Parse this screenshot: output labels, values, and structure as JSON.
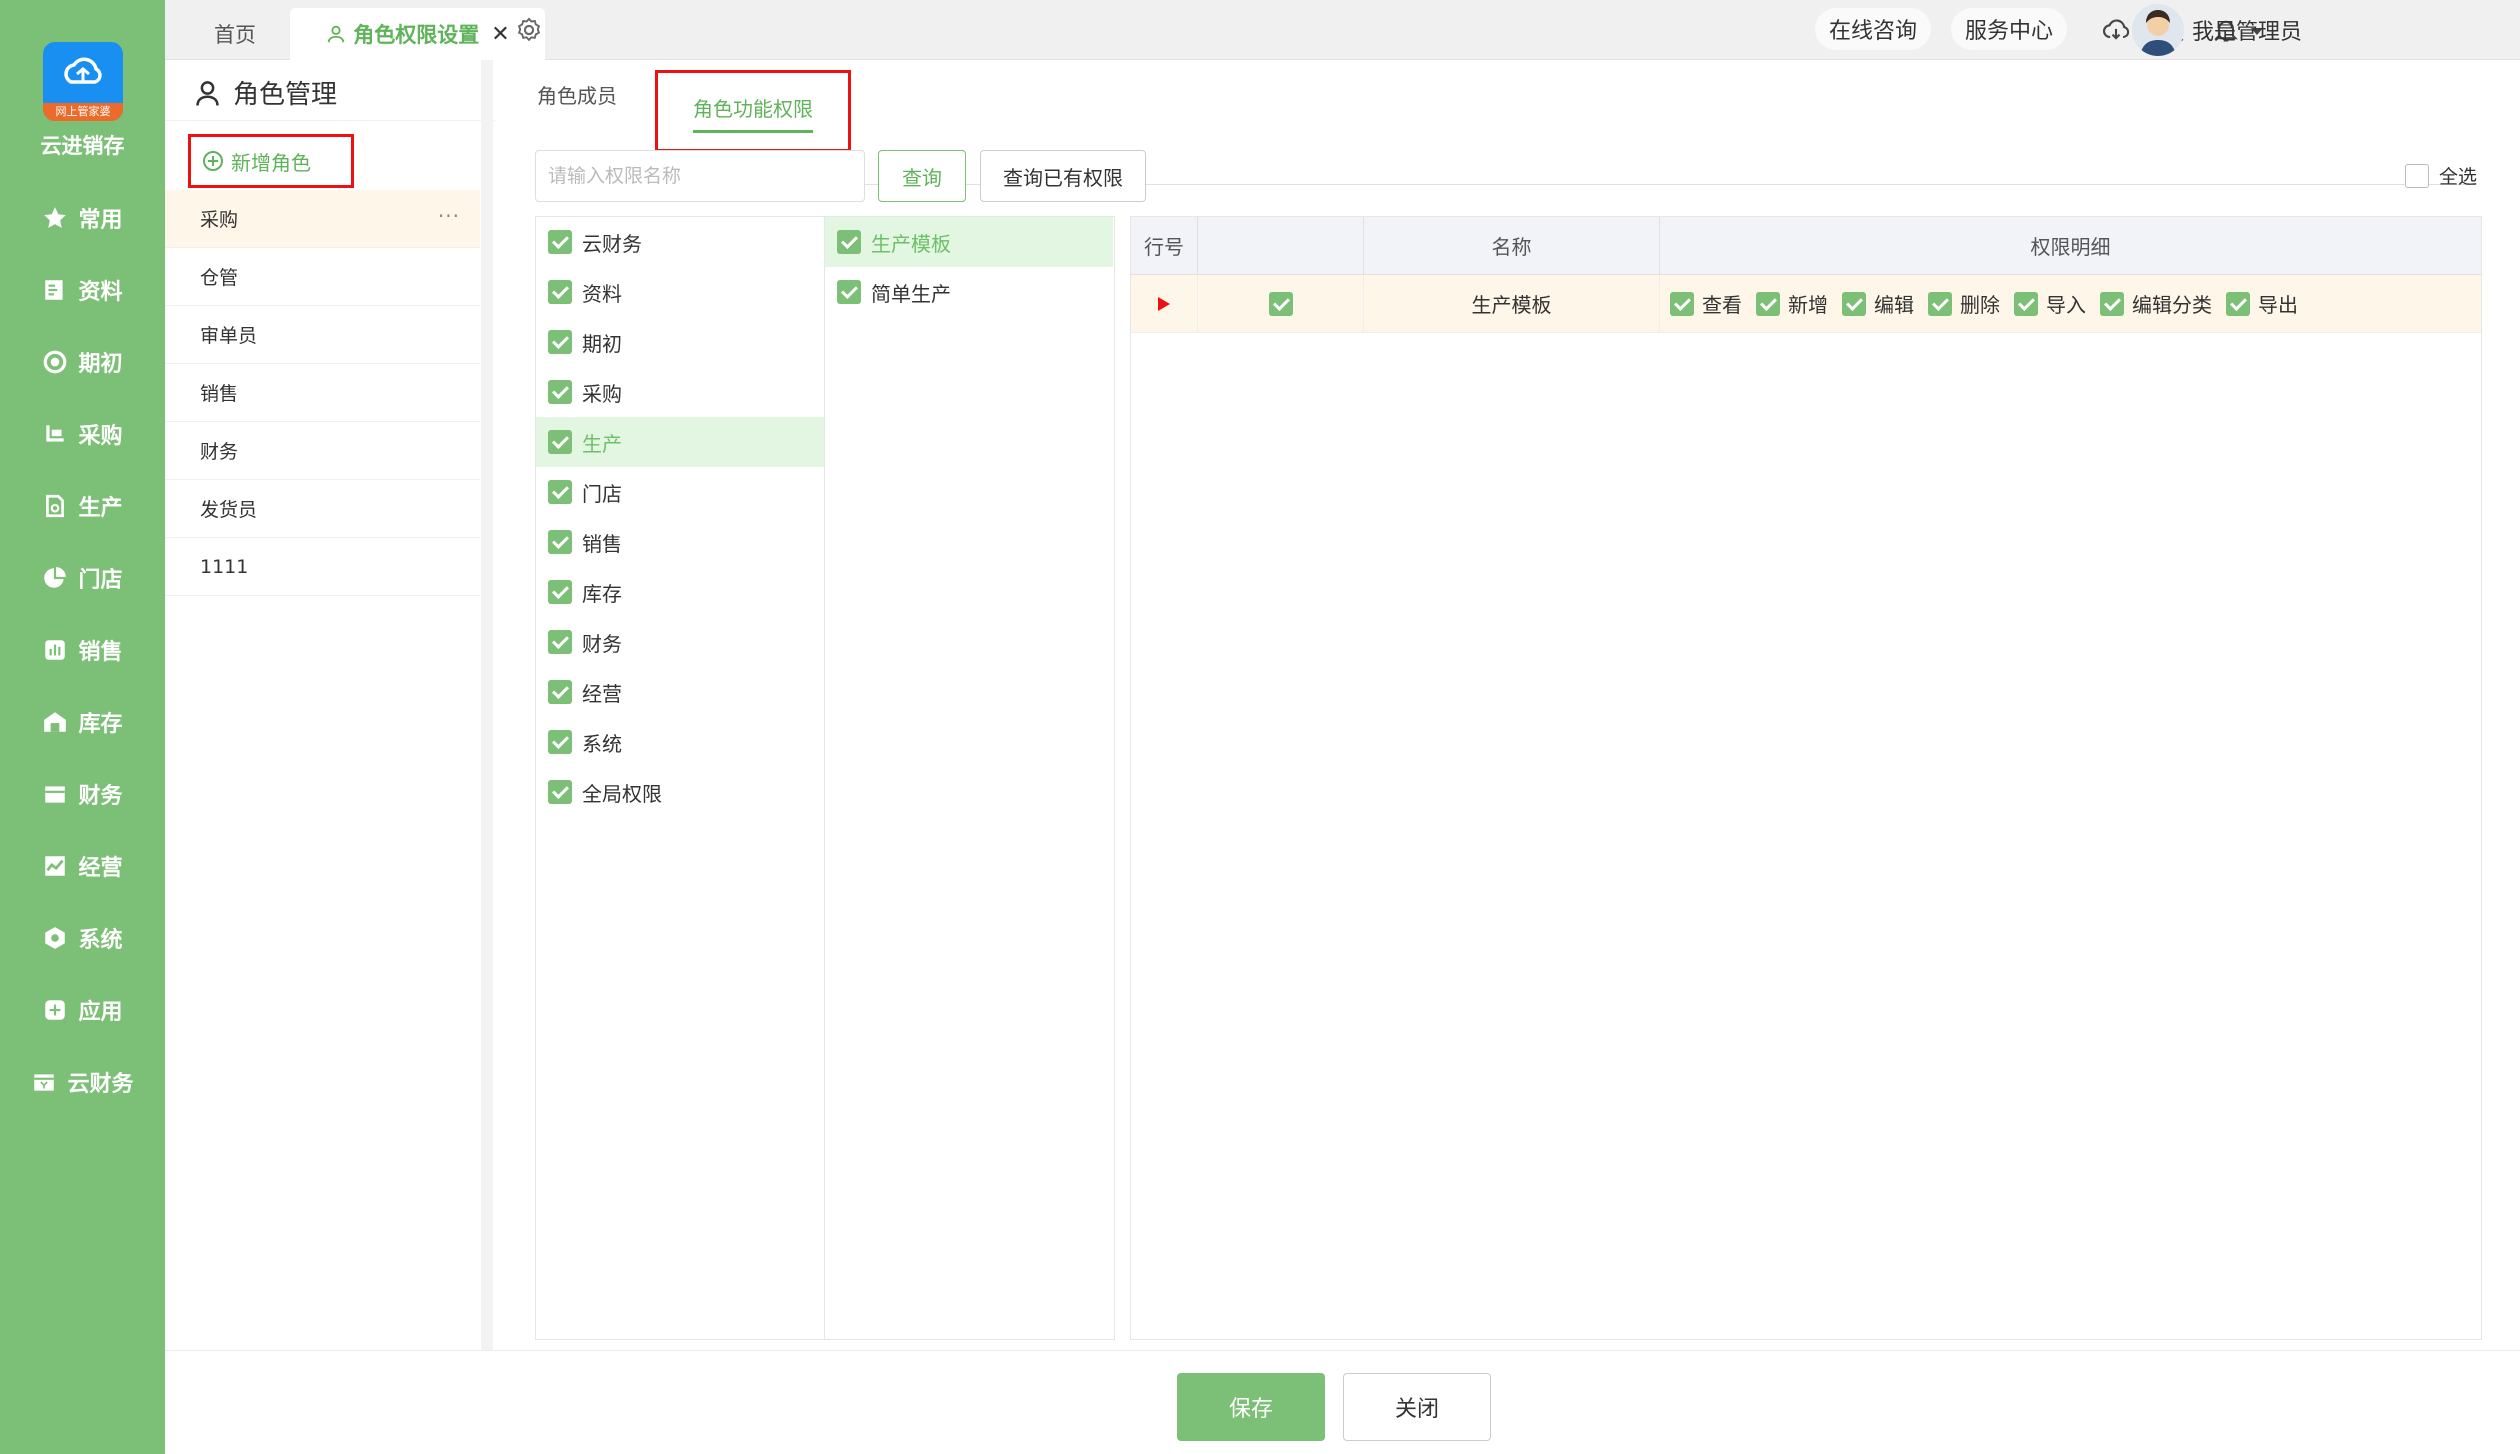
{
  "app": {
    "logo_strip": "网上管家婆",
    "name": "云进销存"
  },
  "nav": [
    {
      "label": "常用",
      "icon": "star-icon"
    },
    {
      "label": "资料",
      "icon": "document-icon"
    },
    {
      "label": "期初",
      "icon": "target-icon"
    },
    {
      "label": "采购",
      "icon": "cart-icon"
    },
    {
      "label": "生产",
      "icon": "production-icon"
    },
    {
      "label": "门店",
      "icon": "pie-chart-icon"
    },
    {
      "label": "销售",
      "icon": "bar-chart-icon"
    },
    {
      "label": "库存",
      "icon": "warehouse-icon"
    },
    {
      "label": "财务",
      "icon": "wallet-icon"
    },
    {
      "label": "经营",
      "icon": "trend-chart-icon"
    },
    {
      "label": "系统",
      "icon": "hexagon-icon"
    },
    {
      "label": "应用",
      "icon": "plus-square-icon"
    },
    {
      "label": "云财务",
      "icon": "cloud-finance-icon"
    }
  ],
  "topbar": {
    "tab_home": "首页",
    "tab_active": "角色权限设置",
    "tab_close": "✕",
    "online_consult": "在线咨询",
    "service_center": "服务中心",
    "user_name": "我是管理员"
  },
  "role_panel": {
    "title": "角色管理",
    "add_role": "新增角色",
    "more": "···",
    "roles": [
      "采购",
      "仓管",
      "审单员",
      "销售",
      "财务",
      "发货员",
      "1111"
    ]
  },
  "main": {
    "tab_members": "角色成员",
    "tab_permissions": "角色功能权限",
    "search_placeholder": "请输入权限名称",
    "query_button": "查询",
    "query_existing_button": "查询已有权限",
    "select_all": "全选",
    "modules": [
      "云财务",
      "资料",
      "期初",
      "采购",
      "生产",
      "门店",
      "销售",
      "库存",
      "财务",
      "经营",
      "系统",
      "全局权限"
    ],
    "active_module": "生产",
    "sub_items": [
      "生产模板",
      "简单生产"
    ],
    "active_sub_item": "生产模板",
    "grid": {
      "headers": [
        "行号",
        "名称",
        "权限明细"
      ],
      "rows": [
        {
          "name": "生产模板",
          "perms": [
            "查看",
            "新增",
            "编辑",
            "删除",
            "导入",
            "编辑分类",
            "导出"
          ]
        }
      ]
    }
  },
  "footer": {
    "save": "保存",
    "close": "关闭"
  },
  "colors": {
    "accent": "#7cbf76",
    "highlight": "#e11111",
    "active_row": "#fdf6e9"
  }
}
